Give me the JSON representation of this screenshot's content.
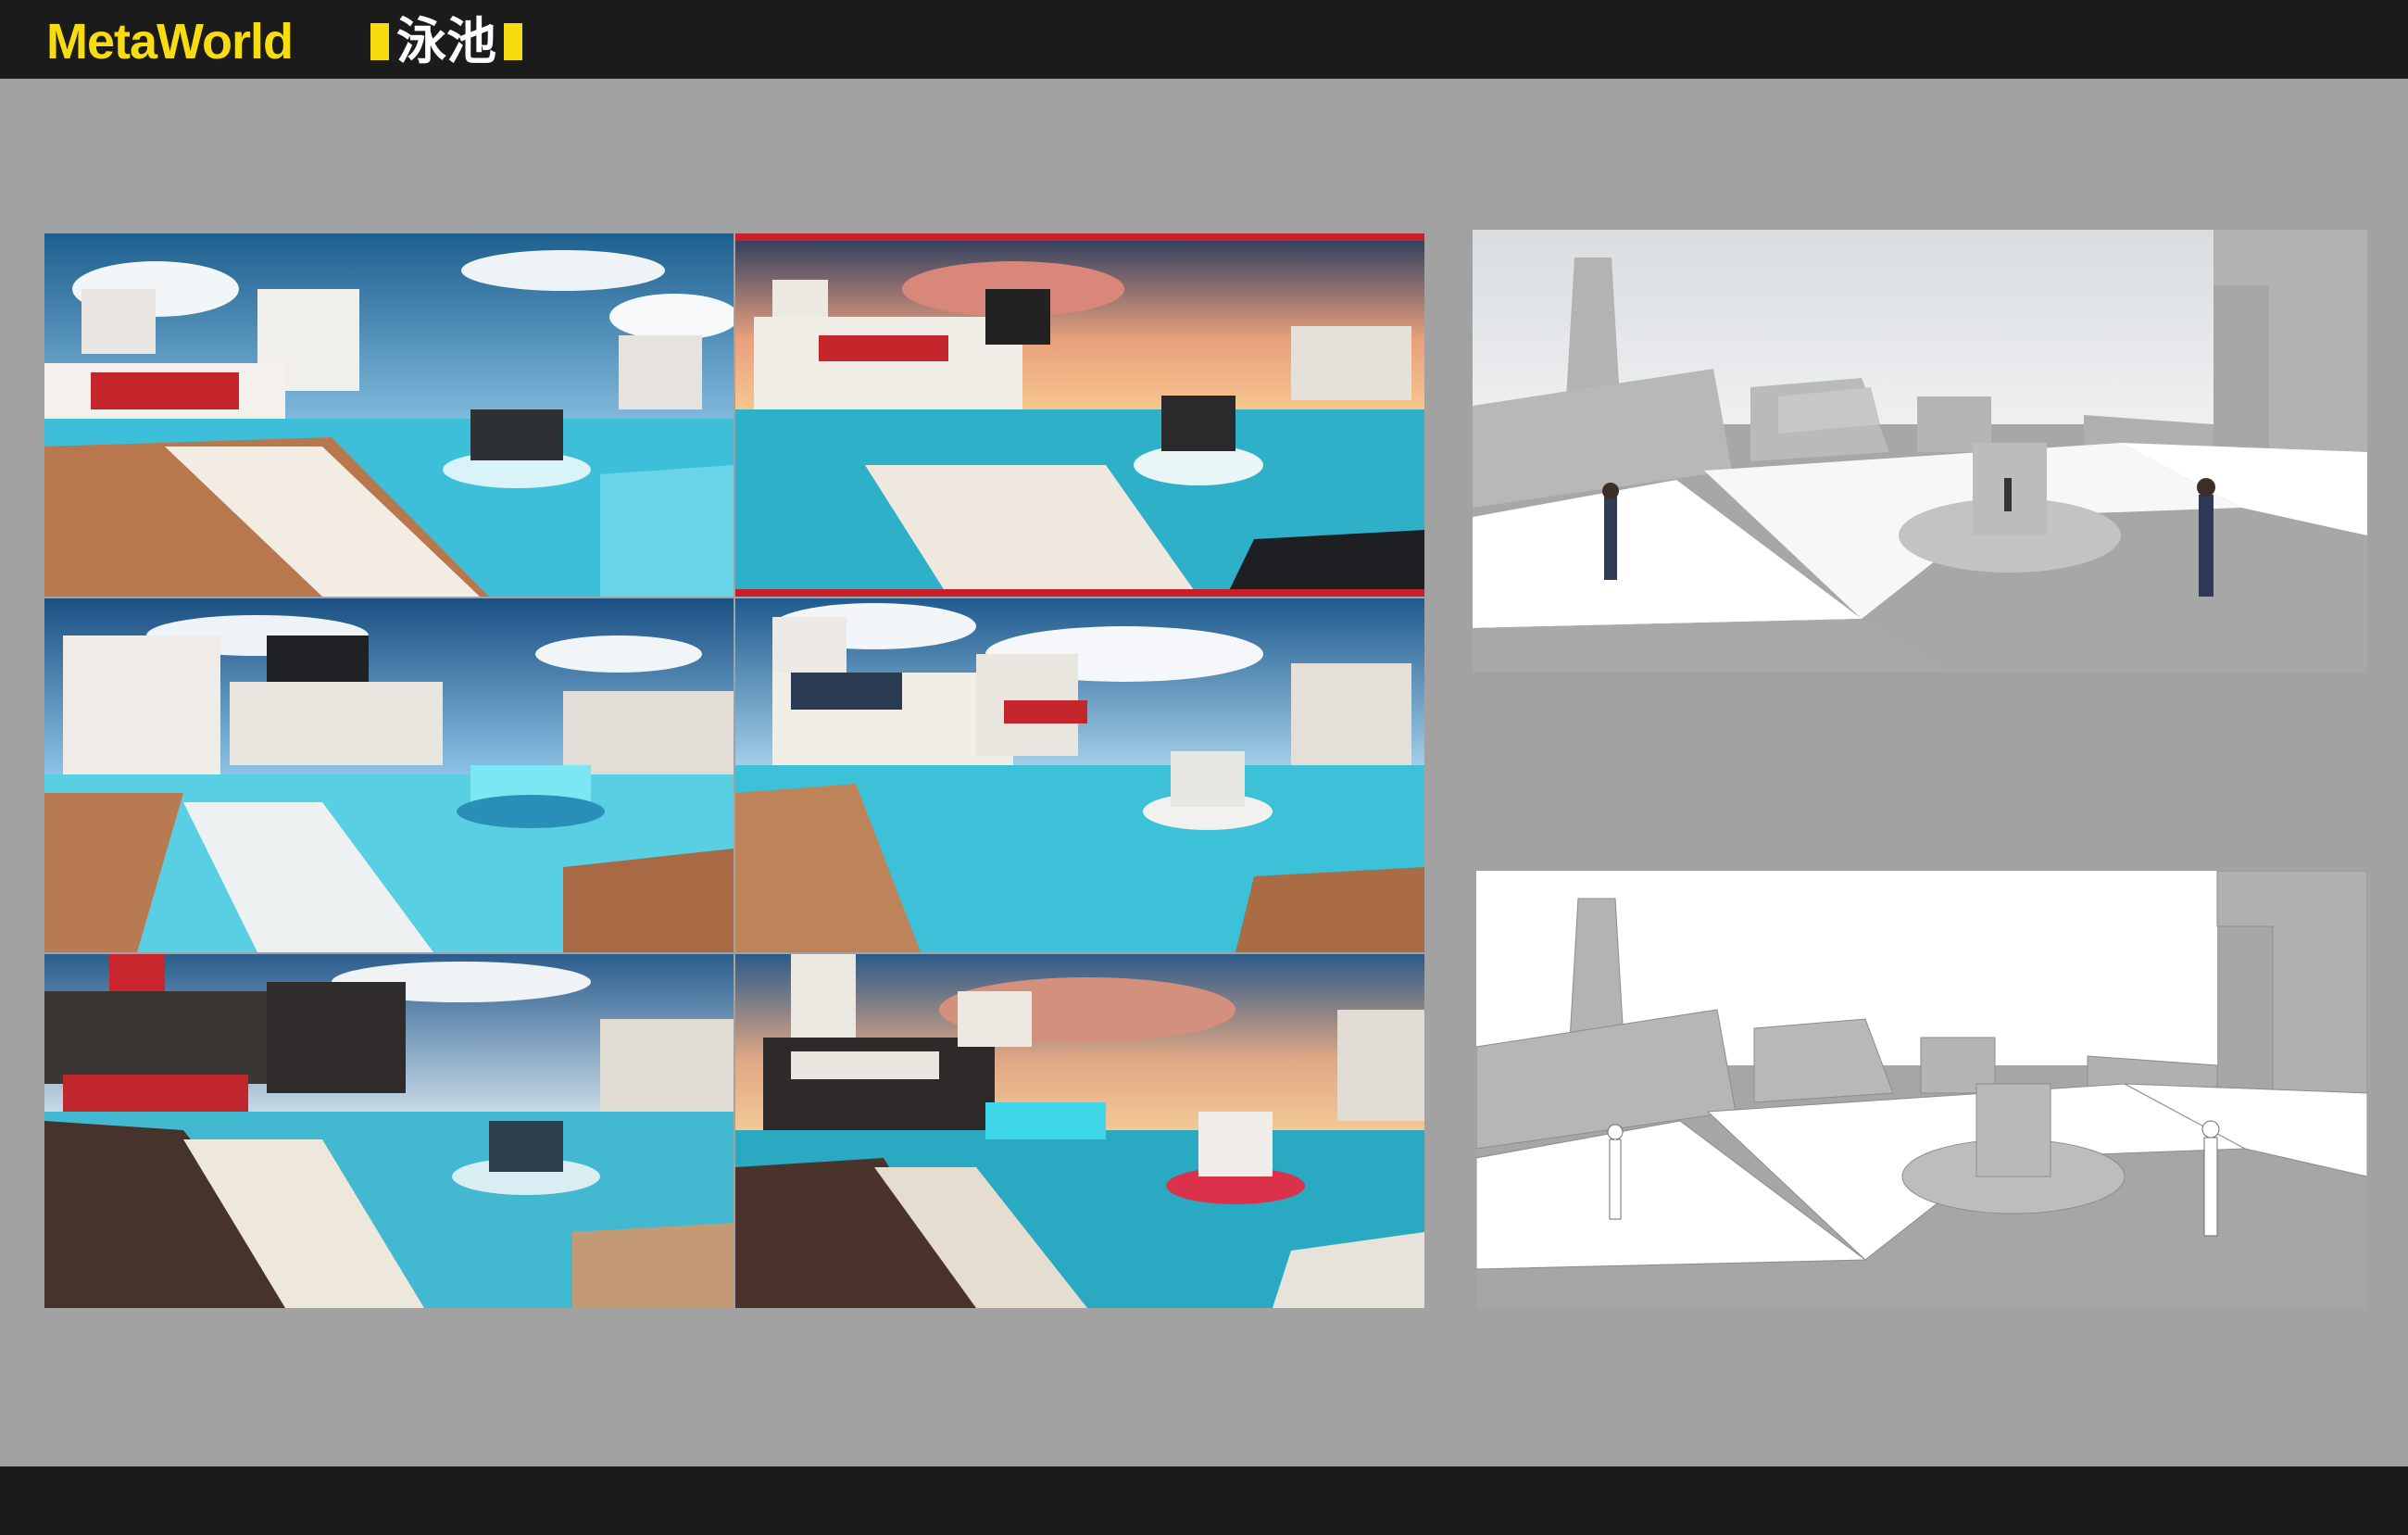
{
  "header": {
    "brand": "MetaWorld",
    "title": "泳池"
  },
  "colors": {
    "header_bg": "#1b1b1b",
    "brand_yellow": "#f7dc0f",
    "canvas_gray": "#a2a2a2"
  },
  "gallery": {
    "renders": [
      {
        "name": "render-daylight-1",
        "time": "day"
      },
      {
        "name": "render-sunset-1",
        "time": "sunset"
      },
      {
        "name": "render-daylight-2",
        "time": "day"
      },
      {
        "name": "render-daylight-3",
        "time": "day"
      },
      {
        "name": "render-evening-1",
        "time": "evening"
      },
      {
        "name": "render-sunset-2",
        "time": "sunset"
      }
    ],
    "models": [
      {
        "name": "model-shaded",
        "style": "shaded"
      },
      {
        "name": "model-lineart",
        "style": "line"
      }
    ]
  }
}
